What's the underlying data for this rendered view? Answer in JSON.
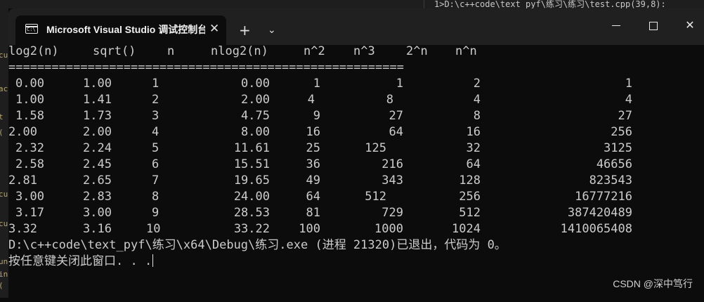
{
  "background": {
    "ide_path": "1>D:\\c++code\\text_pyf\\练习\\练习\\test.cpp(39,8): ",
    "left_fragments": [
      "cu",
      "ac",
      "t",
      "(",
      "cu",
      "cu",
      "un",
      "in",
      "("
    ]
  },
  "window": {
    "tab_title": "Microsoft Visual Studio 调试控制台",
    "tab_icon_text": "C:\\"
  },
  "console": {
    "headers": [
      "log2(n)",
      "sqrt()",
      "n",
      "nlog2(n)",
      "n^2",
      "n^3",
      "2^n",
      "n^n"
    ],
    "separator": "=======================================================",
    "rows": [
      [
        "0.00",
        "1.00",
        "1",
        "0.00",
        "1",
        "1",
        "2",
        "1"
      ],
      [
        "1.00",
        "1.41",
        "2",
        "2.00",
        "4",
        "8",
        "4",
        "4"
      ],
      [
        "1.58",
        "1.73",
        "3",
        "4.75",
        "9",
        "27",
        "8",
        "27"
      ],
      [
        "2.00",
        "2.00",
        "4",
        "8.00",
        "16",
        "64",
        "16",
        "256"
      ],
      [
        "2.32",
        "2.24",
        "5",
        "11.61",
        "25",
        "125",
        "32",
        "3125"
      ],
      [
        "2.58",
        "2.45",
        "6",
        "15.51",
        "36",
        "216",
        "64",
        "46656"
      ],
      [
        "2.81",
        "2.65",
        "7",
        "19.65",
        "49",
        "343",
        "128",
        "823543"
      ],
      [
        "3.00",
        "2.83",
        "8",
        "24.00",
        "64",
        "512",
        "256",
        "16777216"
      ],
      [
        "3.17",
        "3.00",
        "9",
        "28.53",
        "81",
        "729",
        "512",
        "387420489"
      ],
      [
        "3.32",
        "3.16",
        "10",
        "33.22",
        "100",
        "1000",
        "1024",
        "1410065408"
      ]
    ],
    "exit_message": "D:\\c++code\\text_pyf\\练习\\x64\\Debug\\练习.exe (进程 21320)已退出，代码为 0。",
    "close_prompt": "按任意键关闭此窗口. . ."
  },
  "watermark": "CSDN @深中笃行"
}
